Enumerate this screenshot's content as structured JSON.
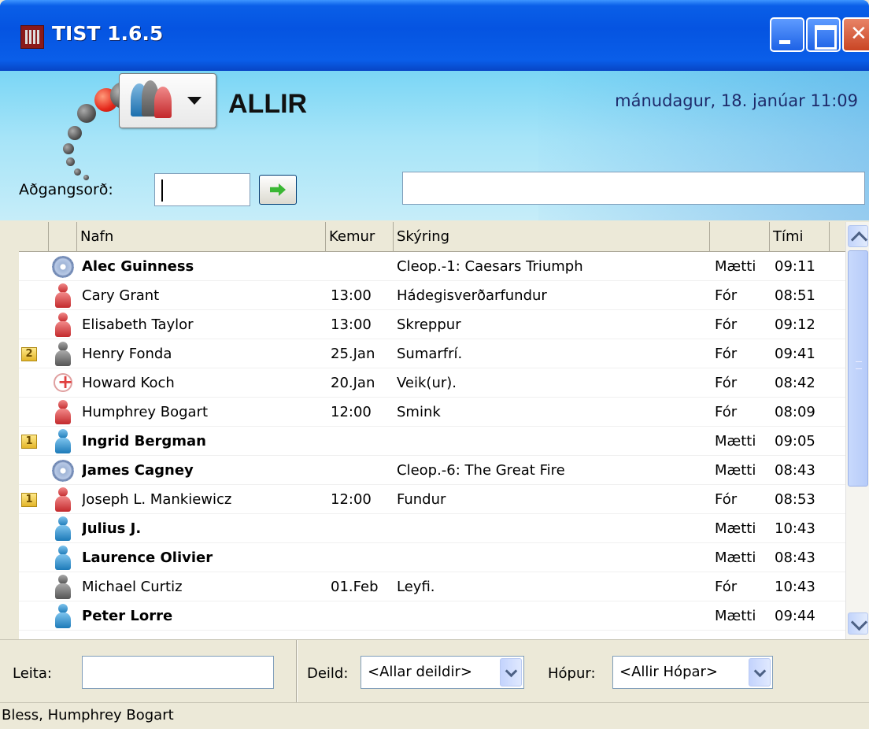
{
  "window": {
    "title": "TIST 1.6.5"
  },
  "header": {
    "group_title": "ALLIR",
    "datetime": "mánudagur, 18. janúar  11:09"
  },
  "access": {
    "label": "Aðgangsorð:",
    "value": "",
    "message": ""
  },
  "table": {
    "columns": [
      "Nafn",
      "Kemur",
      "Skýring",
      "",
      "Tími"
    ],
    "rows": [
      {
        "badge": "",
        "icon": "gear-icon",
        "name": "Alec Guinness",
        "bold": true,
        "kemur": "",
        "skyring": "Cleop.-1: Caesars Triumph",
        "status": "Mætti",
        "time": "09:11"
      },
      {
        "badge": "",
        "icon": "person-red-icon",
        "name": "Cary Grant",
        "bold": false,
        "kemur": "13:00",
        "skyring": "Hádegisverðarfundur",
        "status": "Fór",
        "time": "08:51"
      },
      {
        "badge": "",
        "icon": "person-red-icon",
        "name": "Elisabeth Taylor",
        "bold": false,
        "kemur": "13:00",
        "skyring": "Skreppur",
        "status": "Fór",
        "time": "09:12"
      },
      {
        "badge": "2",
        "icon": "person-grey-icon",
        "name": "Henry Fonda",
        "bold": false,
        "kemur": "25.Jan",
        "skyring": "Sumarfrí.",
        "status": "Fór",
        "time": "09:41"
      },
      {
        "badge": "",
        "icon": "medical-cross-icon",
        "name": "Howard Koch",
        "bold": false,
        "kemur": "20.Jan",
        "skyring": "Veik(ur).",
        "status": "Fór",
        "time": "08:42"
      },
      {
        "badge": "",
        "icon": "person-red-icon",
        "name": "Humphrey Bogart",
        "bold": false,
        "kemur": "12:00",
        "skyring": "Smink",
        "status": "Fór",
        "time": "08:09"
      },
      {
        "badge": "1",
        "icon": "person-blue-icon",
        "name": "Ingrid Bergman",
        "bold": true,
        "kemur": "",
        "skyring": "",
        "status": "Mætti",
        "time": "09:05"
      },
      {
        "badge": "",
        "icon": "gear-icon",
        "name": "James Cagney",
        "bold": true,
        "kemur": "",
        "skyring": "Cleop.-6: The Great Fire",
        "status": "Mætti",
        "time": "08:43"
      },
      {
        "badge": "1",
        "icon": "person-red-icon",
        "name": "Joseph L. Mankiewicz",
        "bold": false,
        "kemur": "12:00",
        "skyring": "Fundur",
        "status": "Fór",
        "time": "08:53"
      },
      {
        "badge": "",
        "icon": "person-blue-icon",
        "name": "Julius J.",
        "bold": true,
        "kemur": "",
        "skyring": "",
        "status": "Mætti",
        "time": "10:43"
      },
      {
        "badge": "",
        "icon": "person-blue-icon",
        "name": "Laurence Olivier",
        "bold": true,
        "kemur": "",
        "skyring": "",
        "status": "Mætti",
        "time": "08:43"
      },
      {
        "badge": "",
        "icon": "person-grey-icon",
        "name": "Michael Curtiz",
        "bold": false,
        "kemur": "01.Feb",
        "skyring": "Leyfi.",
        "status": "Fór",
        "time": "10:43"
      },
      {
        "badge": "",
        "icon": "person-blue-icon",
        "name": "Peter Lorre",
        "bold": true,
        "kemur": "",
        "skyring": "",
        "status": "Mætti",
        "time": "09:44"
      }
    ]
  },
  "filters": {
    "search_label": "Leita:",
    "search_value": "",
    "department_label": "Deild:",
    "department_value": "<Allar deildir>",
    "group_label": "Hópur:",
    "group_value": "<Allir Hópar>"
  },
  "status": {
    "text": "Bless, Humphrey Bogart"
  }
}
